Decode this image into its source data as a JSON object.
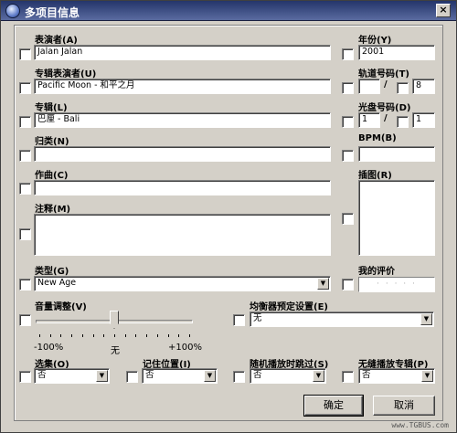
{
  "window": {
    "title": "多项目信息",
    "icon": "app-icon",
    "close_glyph": "×"
  },
  "fields": {
    "artist": {
      "label": "表演者(A)",
      "value": "Jalan Jalan"
    },
    "album_artist": {
      "label": "专辑表演者(U)",
      "value": "Pacific Moon - 和平之月"
    },
    "album": {
      "label": "专辑(L)",
      "value": "巴厘 - Bali"
    },
    "grouping": {
      "label": "归类(N)",
      "value": ""
    },
    "composer": {
      "label": "作曲(C)",
      "value": ""
    },
    "comments": {
      "label": "注释(M)",
      "value": ""
    },
    "genre": {
      "label": "类型(G)",
      "value": "New Age"
    },
    "year": {
      "label": "年份(Y)",
      "value": "2001"
    },
    "track": {
      "label": "轨道号码(T)",
      "value": "",
      "of_value": "8",
      "sep": "/"
    },
    "disc": {
      "label": "光盘号码(D)",
      "value": "1",
      "of_value": "1",
      "sep": "/"
    },
    "bpm": {
      "label": "BPM(B)",
      "value": ""
    },
    "artwork": {
      "label": "插图(R)"
    },
    "rating": {
      "label": "我的评价",
      "dots": "· · · · ·"
    }
  },
  "volume": {
    "label": "音量调整(V)",
    "min_label": "-100%",
    "mid_label": "无",
    "max_label": "+100%",
    "value_fraction": 0.5
  },
  "equalizer": {
    "label": "均衡器预定设置(E)",
    "value": "无"
  },
  "compilation": {
    "label": "选集(O)",
    "value": "否"
  },
  "remember_position": {
    "label": "记住位置(I)",
    "value": "否"
  },
  "skip_shuffle": {
    "label": "随机播放时跳过(S)",
    "value": "否"
  },
  "gapless": {
    "label": "无缝播放专辑(P)",
    "value": "否"
  },
  "buttons": {
    "ok": "确定",
    "cancel": "取消"
  },
  "watermark": "www.TGBUS.com"
}
